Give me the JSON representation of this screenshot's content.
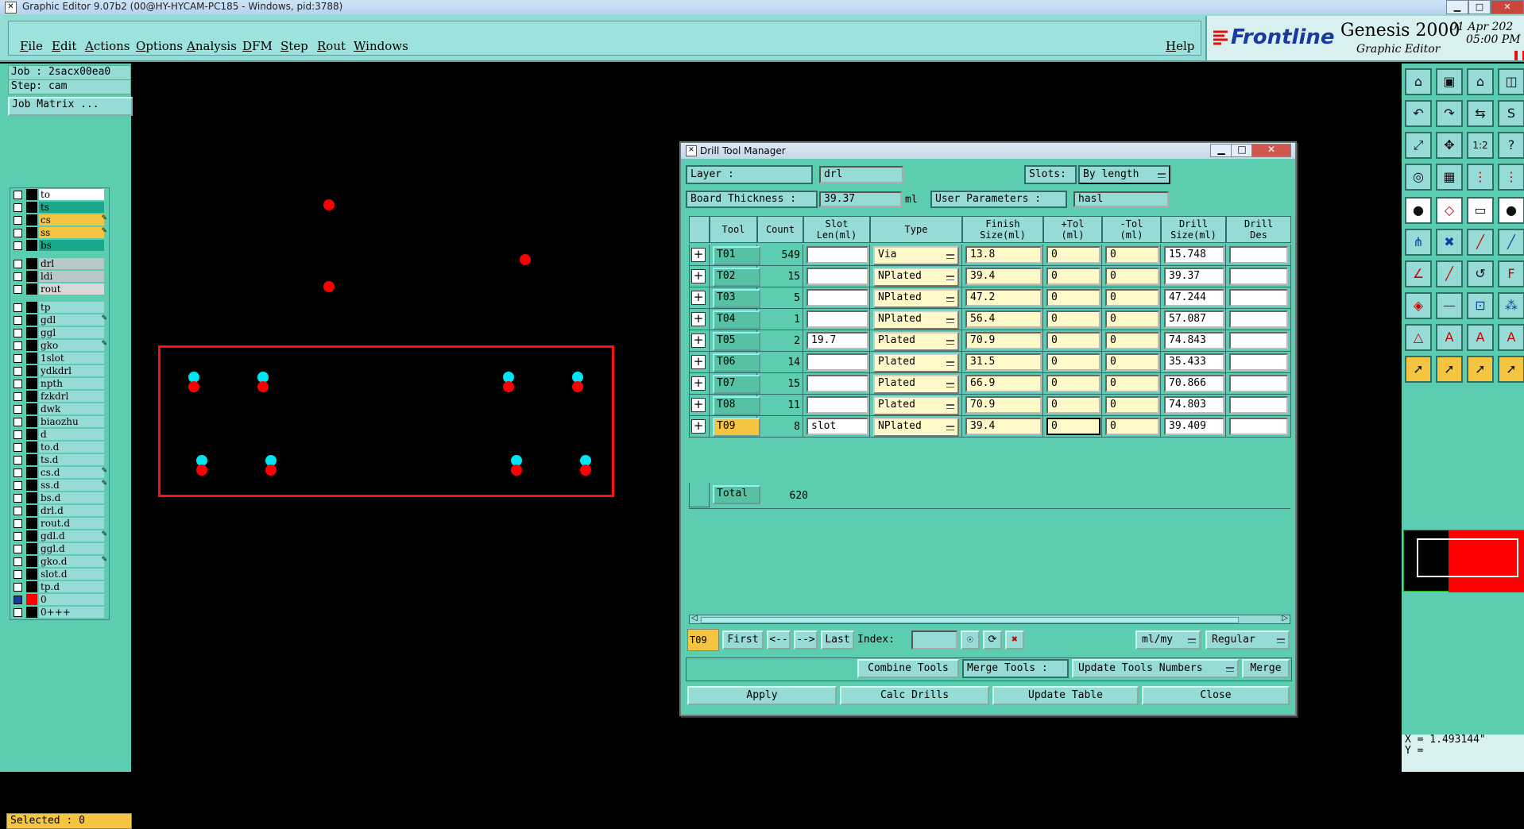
{
  "window": {
    "title": "Graphic Editor 9.07b2 (00@HY-HYCAM-PC185 - Windows, pid:3788)",
    "btn_min": "▁",
    "btn_max": "□",
    "btn_close": "✕"
  },
  "menubar": {
    "items": [
      "File",
      "Edit",
      "Actions",
      "Options",
      "Analysis",
      "DFM",
      "Step",
      "Rout",
      "Windows"
    ],
    "help": "Help",
    "brand": "Frontline",
    "product": "Genesis 2000",
    "subtitle": "Graphic Editor",
    "date": "01 Apr 202",
    "time": "05:00 PM"
  },
  "left": {
    "job": "Job : 2sacx00ea0",
    "step": "Step: cam",
    "job_matrix": "Job Matrix ...",
    "selected": "Selected : 0",
    "layers_group1": [
      {
        "name": "to",
        "color": "#ffffff",
        "marker": ""
      },
      {
        "name": "ts",
        "color": "#1aa88a",
        "marker": ""
      },
      {
        "name": "cs",
        "color": "#f5c542",
        "marker": "✎"
      },
      {
        "name": "ss",
        "color": "#f5c542",
        "marker": "✎"
      },
      {
        "name": "bs",
        "color": "#1aa88a",
        "marker": ""
      }
    ],
    "layers_group2": [
      {
        "name": "drl",
        "color": "#b8c8c8",
        "marker": ""
      },
      {
        "name": "ldi",
        "color": "#b8c8c8",
        "marker": ""
      },
      {
        "name": "rout",
        "color": "#d8d8d8",
        "marker": ""
      }
    ],
    "layers_group3": [
      {
        "name": "tp",
        "color": "#97dbd6",
        "marker": ""
      },
      {
        "name": "gdl",
        "color": "#97dbd6",
        "marker": "✎"
      },
      {
        "name": "ggl",
        "color": "#97dbd6",
        "marker": ""
      },
      {
        "name": "gko",
        "color": "#97dbd6",
        "marker": "✎"
      },
      {
        "name": "1slot",
        "color": "#97dbd6",
        "marker": ""
      },
      {
        "name": "ydkdrl",
        "color": "#97dbd6",
        "marker": ""
      },
      {
        "name": "npth",
        "color": "#97dbd6",
        "marker": ""
      },
      {
        "name": "fzkdrl",
        "color": "#97dbd6",
        "marker": ""
      },
      {
        "name": "dwk",
        "color": "#97dbd6",
        "marker": ""
      },
      {
        "name": "biaozhu",
        "color": "#97dbd6",
        "marker": ""
      },
      {
        "name": "d",
        "color": "#97dbd6",
        "marker": ""
      },
      {
        "name": "to.d",
        "color": "#97dbd6",
        "marker": ""
      },
      {
        "name": "ts.d",
        "color": "#97dbd6",
        "marker": ""
      },
      {
        "name": "cs.d",
        "color": "#97dbd6",
        "marker": "✎"
      },
      {
        "name": "ss.d",
        "color": "#97dbd6",
        "marker": "✎"
      },
      {
        "name": "bs.d",
        "color": "#97dbd6",
        "marker": ""
      },
      {
        "name": "drl.d",
        "color": "#97dbd6",
        "marker": ""
      },
      {
        "name": "rout.d",
        "color": "#97dbd6",
        "marker": ""
      },
      {
        "name": "gdl.d",
        "color": "#97dbd6",
        "marker": "✎"
      },
      {
        "name": "ggl.d",
        "color": "#97dbd6",
        "marker": ""
      },
      {
        "name": "gko.d",
        "color": "#97dbd6",
        "marker": "✎"
      },
      {
        "name": "slot.d",
        "color": "#97dbd6",
        "marker": ""
      },
      {
        "name": "tp.d",
        "color": "#97dbd6",
        "marker": ""
      },
      {
        "name": "0",
        "color": "#97dbd6",
        "marker": ""
      },
      {
        "name": "0+++",
        "color": "#97dbd6",
        "marker": ""
      }
    ]
  },
  "dialog": {
    "title": "Drill Tool Manager",
    "layer_label": "Layer         :",
    "layer_value": "drl",
    "slots_label": "Slots:",
    "slots_value": "By length",
    "board_thickness_label": "Board Thickness :",
    "board_thickness_value": "39.37",
    "units_ml": "ml",
    "user_params_label": "User Parameters :",
    "user_params_value": "hasl",
    "headers": [
      "Tool",
      "Count",
      "Slot\nLen(ml)",
      "Type",
      "Finish\nSize(ml)",
      "+Tol\n(ml)",
      "-Tol\n(ml)",
      "Drill\nSize(ml)",
      "Drill\nDes"
    ],
    "rows": [
      {
        "tool": "T01",
        "count": "549",
        "slot": "",
        "type": "Via",
        "finish": "13.8",
        "ptol": "0",
        "ntol": "0",
        "drill": "15.748",
        "des": ""
      },
      {
        "tool": "T02",
        "count": "15",
        "slot": "",
        "type": "NPlated",
        "finish": "39.4",
        "ptol": "0",
        "ntol": "0",
        "drill": "39.37",
        "des": ""
      },
      {
        "tool": "T03",
        "count": "5",
        "slot": "",
        "type": "NPlated",
        "finish": "47.2",
        "ptol": "0",
        "ntol": "0",
        "drill": "47.244",
        "des": ""
      },
      {
        "tool": "T04",
        "count": "1",
        "slot": "",
        "type": "NPlated",
        "finish": "56.4",
        "ptol": "0",
        "ntol": "0",
        "drill": "57.087",
        "des": ""
      },
      {
        "tool": "T05",
        "count": "2",
        "slot": "19.7",
        "type": "Plated",
        "finish": "70.9",
        "ptol": "0",
        "ntol": "0",
        "drill": "74.843",
        "des": ""
      },
      {
        "tool": "T06",
        "count": "14",
        "slot": "",
        "type": "Plated",
        "finish": "31.5",
        "ptol": "0",
        "ntol": "0",
        "drill": "35.433",
        "des": ""
      },
      {
        "tool": "T07",
        "count": "15",
        "slot": "",
        "type": "Plated",
        "finish": "66.9",
        "ptol": "0",
        "ntol": "0",
        "drill": "70.866",
        "des": ""
      },
      {
        "tool": "T08",
        "count": "11",
        "slot": "",
        "type": "Plated",
        "finish": "70.9",
        "ptol": "0",
        "ntol": "0",
        "drill": "74.803",
        "des": ""
      },
      {
        "tool": "T09",
        "count": "8",
        "slot": "slot",
        "type": "NPlated",
        "finish": "39.4",
        "ptol": "0",
        "ntol": "0",
        "drill": "39.409",
        "des": ""
      }
    ],
    "total_label": "Total",
    "total_value": "620",
    "nav_current": "T09",
    "nav_first": "First",
    "nav_prev": "<--",
    "nav_next": "-->",
    "nav_last": "Last",
    "index_label": "Index:",
    "units_select": "ml/my",
    "mode_select": "Regular",
    "combine_tools": "Combine Tools",
    "merge_tools_label": "Merge Tools :",
    "update_tools_numbers": "Update Tools Numbers",
    "merge": "Merge",
    "apply": "Apply",
    "calc_drills": "Calc Drills",
    "update_table": "Update Table",
    "close": "Close"
  },
  "coords": {
    "x": "X =  1.493144\"",
    "y": "Y ="
  },
  "colors": {
    "panel": "#5ccdb0",
    "light": "#97dbd6",
    "accent_red": "#ff0000",
    "accent_cyan": "#00e5f5",
    "highlight": "#f5c542"
  }
}
